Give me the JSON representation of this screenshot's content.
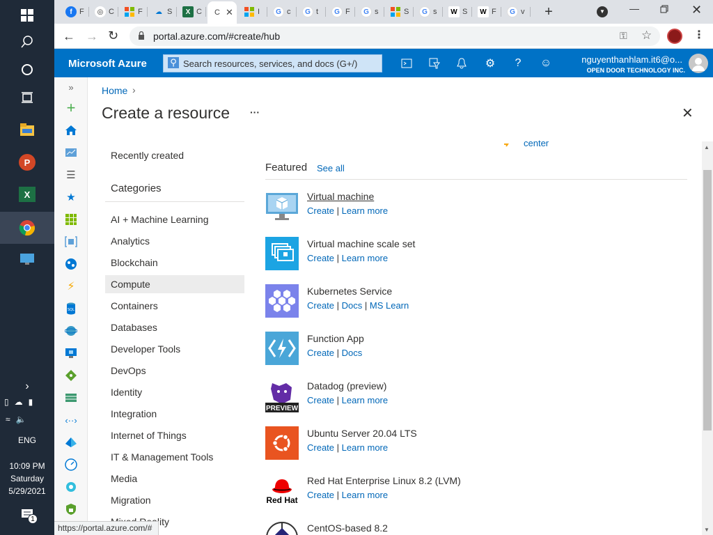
{
  "taskbar": {
    "lang": "ENG",
    "time": "10:09 PM",
    "day": "Saturday",
    "date": "5/29/2021",
    "notification_count": "1"
  },
  "browser": {
    "tabs": [
      {
        "icon": "facebook",
        "letter": "F"
      },
      {
        "icon": "target",
        "letter": "C"
      },
      {
        "icon": "microsoft",
        "letter": "F"
      },
      {
        "icon": "onedrive",
        "letter": "S"
      },
      {
        "icon": "excel",
        "letter": "C"
      },
      {
        "icon": "azure",
        "letter": "C",
        "active": true
      },
      {
        "icon": "microsoft",
        "letter": "I"
      },
      {
        "icon": "google",
        "letter": "c"
      },
      {
        "icon": "google",
        "letter": "t"
      },
      {
        "icon": "google",
        "letter": "F"
      },
      {
        "icon": "google",
        "letter": "s"
      },
      {
        "icon": "microsoft",
        "letter": "S"
      },
      {
        "icon": "google",
        "letter": "s"
      },
      {
        "icon": "wikipedia",
        "letter": "S"
      },
      {
        "icon": "wikipedia",
        "letter": "F"
      },
      {
        "icon": "google",
        "letter": "v"
      }
    ],
    "url": "portal.azure.com/#create/hub",
    "status_url": "https://portal.azure.com/#"
  },
  "azure": {
    "brand": "Microsoft Azure",
    "search_placeholder": "Search resources, services, and docs (G+/)",
    "user_email": "nguyenthanhlam.it6@o...",
    "user_org": "OPEN DOOR TECHNOLOGY INC."
  },
  "page": {
    "breadcrumb_home": "Home",
    "title": "Create a resource",
    "more": "···",
    "recently_created": "Recently created",
    "categories_heading": "Categories",
    "categories": [
      "AI + Machine Learning",
      "Analytics",
      "Blockchain",
      "Compute",
      "Containers",
      "Databases",
      "Developer Tools",
      "DevOps",
      "Identity",
      "Integration",
      "Internet of Things",
      "IT & Management Tools",
      "Media",
      "Migration",
      "Mixed Reality"
    ],
    "selected_category": "Compute",
    "partial_link": "center",
    "featured_heading": "Featured",
    "see_all": "See all",
    "featured": [
      {
        "name": "Virtual machine",
        "links": [
          "Create",
          "Learn more"
        ],
        "icon": "vm-icon",
        "color": "#5ba7d8"
      },
      {
        "name": "Virtual machine scale set",
        "links": [
          "Create",
          "Learn more"
        ],
        "icon": "vmss-icon",
        "color": "#1ca4e3"
      },
      {
        "name": "Kubernetes Service",
        "links": [
          "Create",
          "Docs",
          "MS Learn"
        ],
        "icon": "kubernetes-icon",
        "color": "#7b83eb"
      },
      {
        "name": "Function App",
        "links": [
          "Create",
          "Docs"
        ],
        "icon": "function-icon",
        "color": "#4aa6d8"
      },
      {
        "name": "Datadog (preview)",
        "links": [
          "Create",
          "Learn more"
        ],
        "icon": "datadog-icon",
        "color": "#632ca6"
      },
      {
        "name": "Ubuntu Server 20.04 LTS",
        "links": [
          "Create",
          "Learn more"
        ],
        "icon": "ubuntu-icon",
        "color": "#e95420"
      },
      {
        "name": "Red Hat Enterprise Linux 8.2 (LVM)",
        "links": [
          "Create",
          "Learn more"
        ],
        "icon": "redhat-icon",
        "color": "#ee0000"
      },
      {
        "name": "CentOS-based 8.2",
        "links": [],
        "icon": "centos-icon",
        "color": "#262577"
      }
    ],
    "preview_badge": "PREVIEW",
    "redhat_text": "Red Hat"
  }
}
